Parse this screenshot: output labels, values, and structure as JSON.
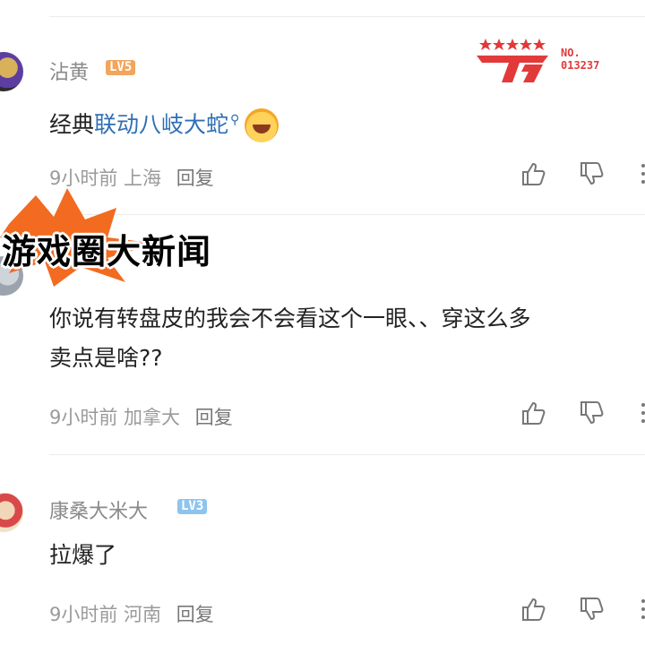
{
  "overlay": {
    "badge_text": "游戏圈大新闻",
    "logo": {
      "no_label": "NO.",
      "number": "013237"
    }
  },
  "comments": [
    {
      "username": "沾黄",
      "level": "LV5",
      "content_prefix": "经典",
      "content_link": "联动八岐大蛇",
      "meta": "9小时前 上海",
      "reply": "回复"
    },
    {
      "username": "",
      "level": "",
      "content_line1": "你说有转盘皮的我会不会看这个一眼、、穿这么多",
      "content_line2": "卖点是啥??",
      "meta": "9小时前 加拿大",
      "reply": "回复"
    },
    {
      "username": "康桑大米大",
      "level": "LV3",
      "content": "拉爆了",
      "meta": "9小时前 河南",
      "reply": "回复"
    }
  ],
  "colors": {
    "link": "#2f6fb5",
    "meta": "#9a9a9a",
    "level5": "#f3a55c",
    "level3": "#8ec4ee",
    "logo_red": "#e23a3a"
  }
}
